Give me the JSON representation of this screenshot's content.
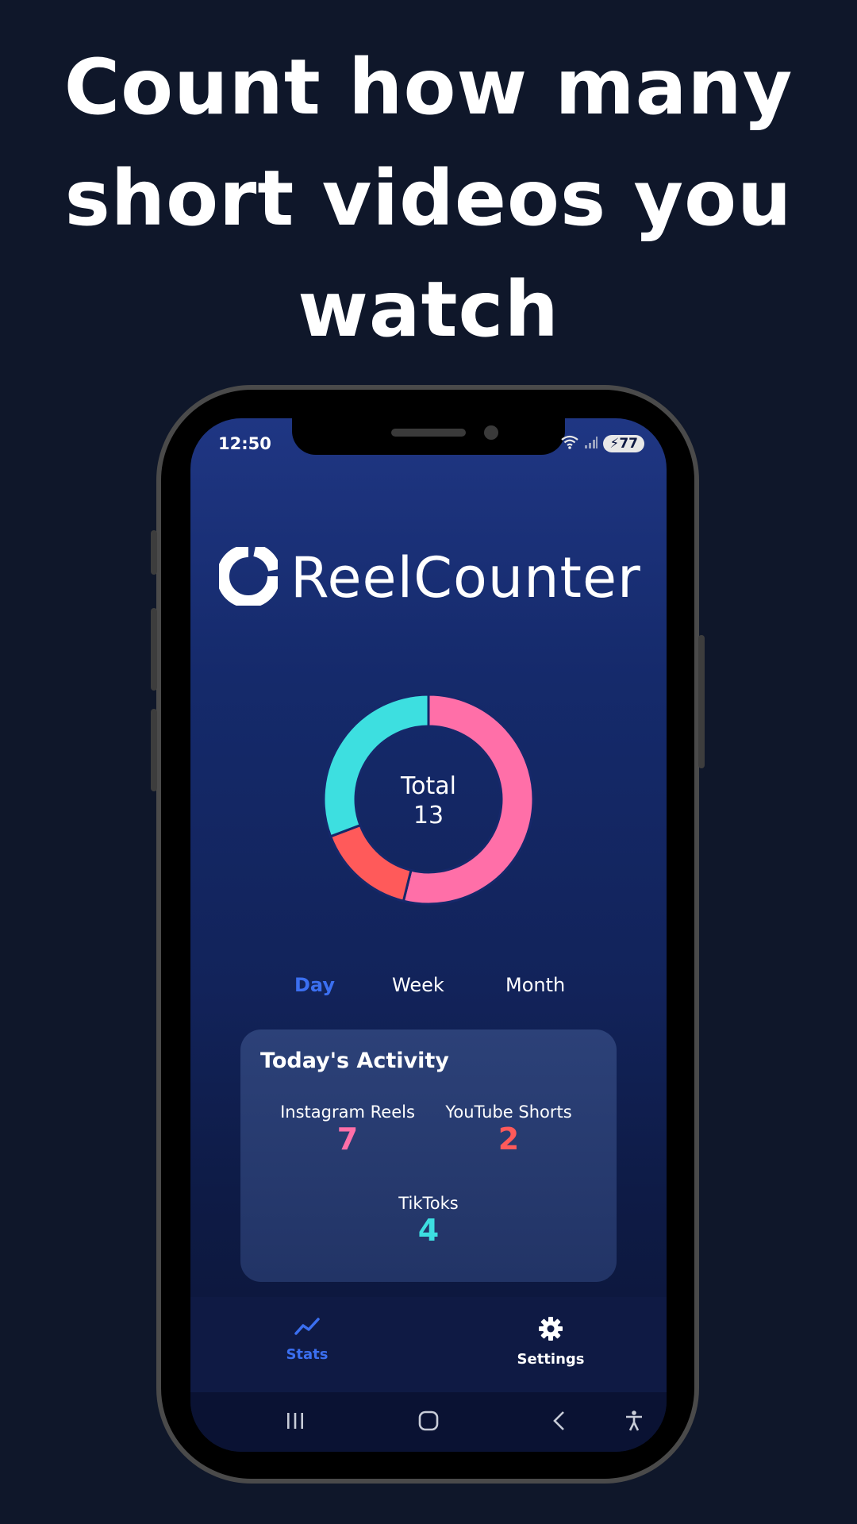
{
  "headline": {
    "line1": "Count how many",
    "line2": "short videos you",
    "line3": "watch"
  },
  "status_bar": {
    "time": "12:50",
    "battery": "77",
    "icons": [
      "wifi-icon",
      "signal-icon",
      "battery-icon"
    ]
  },
  "app": {
    "name": "ReelCounter",
    "logo_icon": "ring-logo-icon"
  },
  "chart_data": {
    "type": "pie",
    "style": "donut",
    "center_label": "Total",
    "center_value": "13",
    "slices": [
      {
        "name": "Instagram Reels",
        "value": 7,
        "color": "#ff6fa8"
      },
      {
        "name": "YouTube Shorts",
        "value": 2,
        "color": "#ff5a5a"
      },
      {
        "name": "TikToks",
        "value": 4,
        "color": "#3ddfe0"
      }
    ]
  },
  "period_tabs": [
    {
      "label": "Day",
      "active": true
    },
    {
      "label": "Week",
      "active": false
    },
    {
      "label": "Month",
      "active": false
    }
  ],
  "activity_card": {
    "title": "Today's Activity",
    "stats": [
      {
        "label": "Instagram Reels",
        "value": "7",
        "color": "#ff6fa8"
      },
      {
        "label": "YouTube Shorts",
        "value": "2",
        "color": "#ff5a5a"
      },
      {
        "label": "TikToks",
        "value": "4",
        "color": "#3ddfe0"
      }
    ]
  },
  "bottom_nav": {
    "items": [
      {
        "label": "Stats",
        "icon": "trend-chart-icon",
        "active": true
      },
      {
        "label": "Settings",
        "icon": "gear-icon",
        "active": false
      }
    ]
  },
  "system_nav": {
    "icons": [
      "recent-apps-icon",
      "home-icon",
      "back-icon",
      "accessibility-icon"
    ]
  },
  "colors": {
    "background": "#0f172a",
    "accent": "#3b6ff0",
    "instagram": "#ff6fa8",
    "youtube": "#ff5a5a",
    "tiktok": "#3ddfe0"
  }
}
